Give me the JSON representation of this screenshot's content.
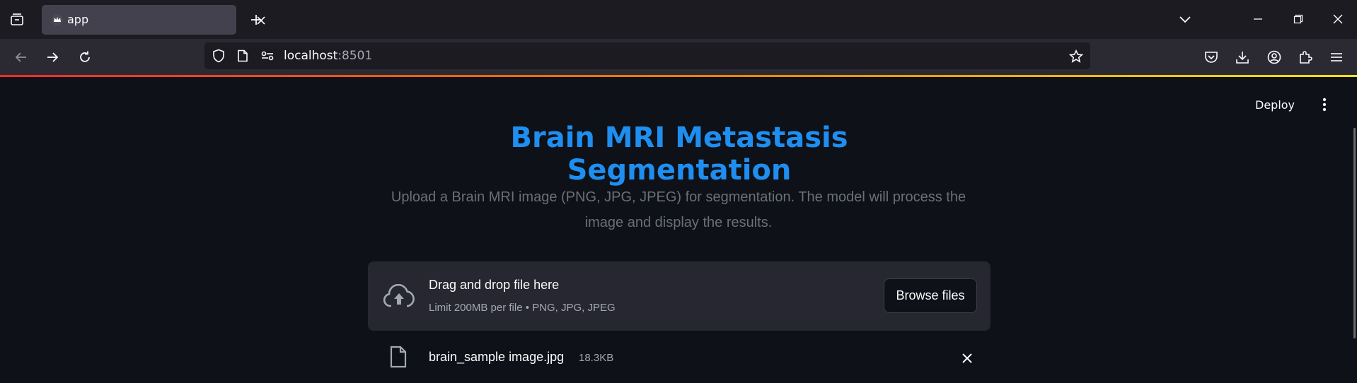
{
  "browser": {
    "tab": {
      "title": "app",
      "favicon": "crown-icon"
    },
    "url": {
      "host": "localhost",
      "port": ":8501"
    },
    "icons": [
      "tab-overview-icon",
      "close-icon",
      "new-tab-icon",
      "tab-list-chevron-icon",
      "minimize-icon",
      "restore-icon",
      "window-close-icon",
      "back-arrow-icon",
      "forward-arrow-icon",
      "reload-icon",
      "shield-icon",
      "page-icon",
      "permissions-icon",
      "bookmark-star-icon",
      "pocket-icon",
      "download-icon",
      "account-icon",
      "extensions-icon",
      "menu-icon"
    ]
  },
  "app": {
    "deploy_label": "Deploy",
    "title": "Brain MRI Metastasis Segmentation",
    "subtitle_line1": "Upload a Brain MRI image (PNG, JPG, JPEG) for segmentation. The model will process the",
    "subtitle_line2": "image and display the results.",
    "uploader": {
      "drop_label": "Drag and drop file here",
      "limit_label": "Limit 200MB per file • PNG, JPG, JPEG",
      "browse_label": "Browse files"
    },
    "uploaded_file": {
      "name": "brain_sample image.jpg",
      "size": "18.3KB"
    }
  },
  "colors": {
    "title": "#1f8ef1",
    "page_background": "#0e1117",
    "dropzone_background": "#262730",
    "accent_gradient": [
      "#ff2b2b",
      "#ff8700",
      "#ffe312"
    ]
  }
}
